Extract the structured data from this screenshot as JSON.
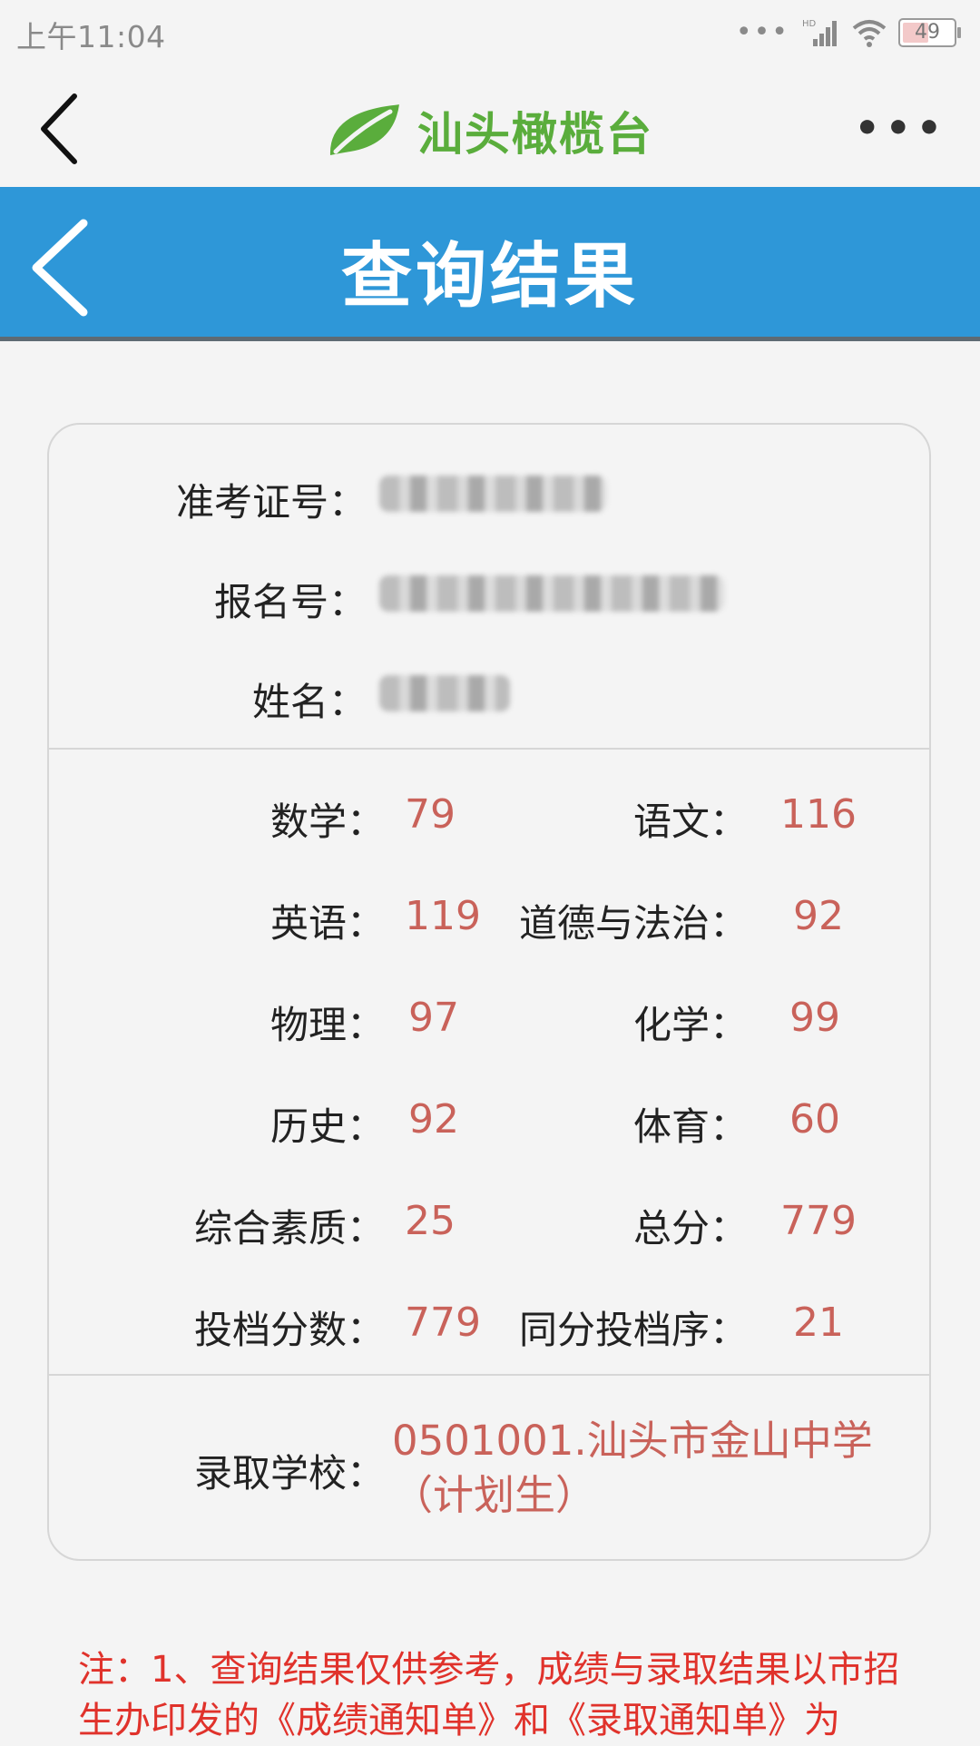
{
  "status_bar": {
    "time": "上午11:04",
    "network": "HD",
    "battery": "49"
  },
  "header": {
    "brand_name": "汕头橄榄台",
    "brand_color": "#5aad3c",
    "more_icon": "more-icon"
  },
  "title_bar": {
    "title": "查询结果",
    "color": "#2e97d8"
  },
  "identity": {
    "exam_id_label": "准考证号：",
    "reg_no_label": "报名号：",
    "name_label": "姓名："
  },
  "scores": {
    "math_label": "数学：",
    "math": "79",
    "chinese_label": "语文：",
    "chinese": "116",
    "english_label": "英语：",
    "english": "119",
    "morality_label": "道德与法治：",
    "morality": "92",
    "physics_label": "物理：",
    "physics": "97",
    "chemistry_label": "化学：",
    "chemistry": "99",
    "history_label": "历史：",
    "history": "92",
    "pe_label": "体育：",
    "pe": "60",
    "quality_label": "综合素质：",
    "quality": "25",
    "total_label": "总分：",
    "total": "779",
    "filing_label": "投档分数：",
    "filing": "779",
    "tie_rank_label": "同分投档序：",
    "tie_rank": "21"
  },
  "admission": {
    "label": "录取学校：",
    "school_line1": "0501001.汕头市金山中学",
    "school_line2": "（计划生）"
  },
  "note": {
    "text": "注：1、查询结果仅供参考，成绩与录取结果以市招生办印发的《成绩通知单》和《录取通知单》为"
  },
  "colors": {
    "value_red": "#c9625a",
    "note_red": "#e0322b"
  }
}
